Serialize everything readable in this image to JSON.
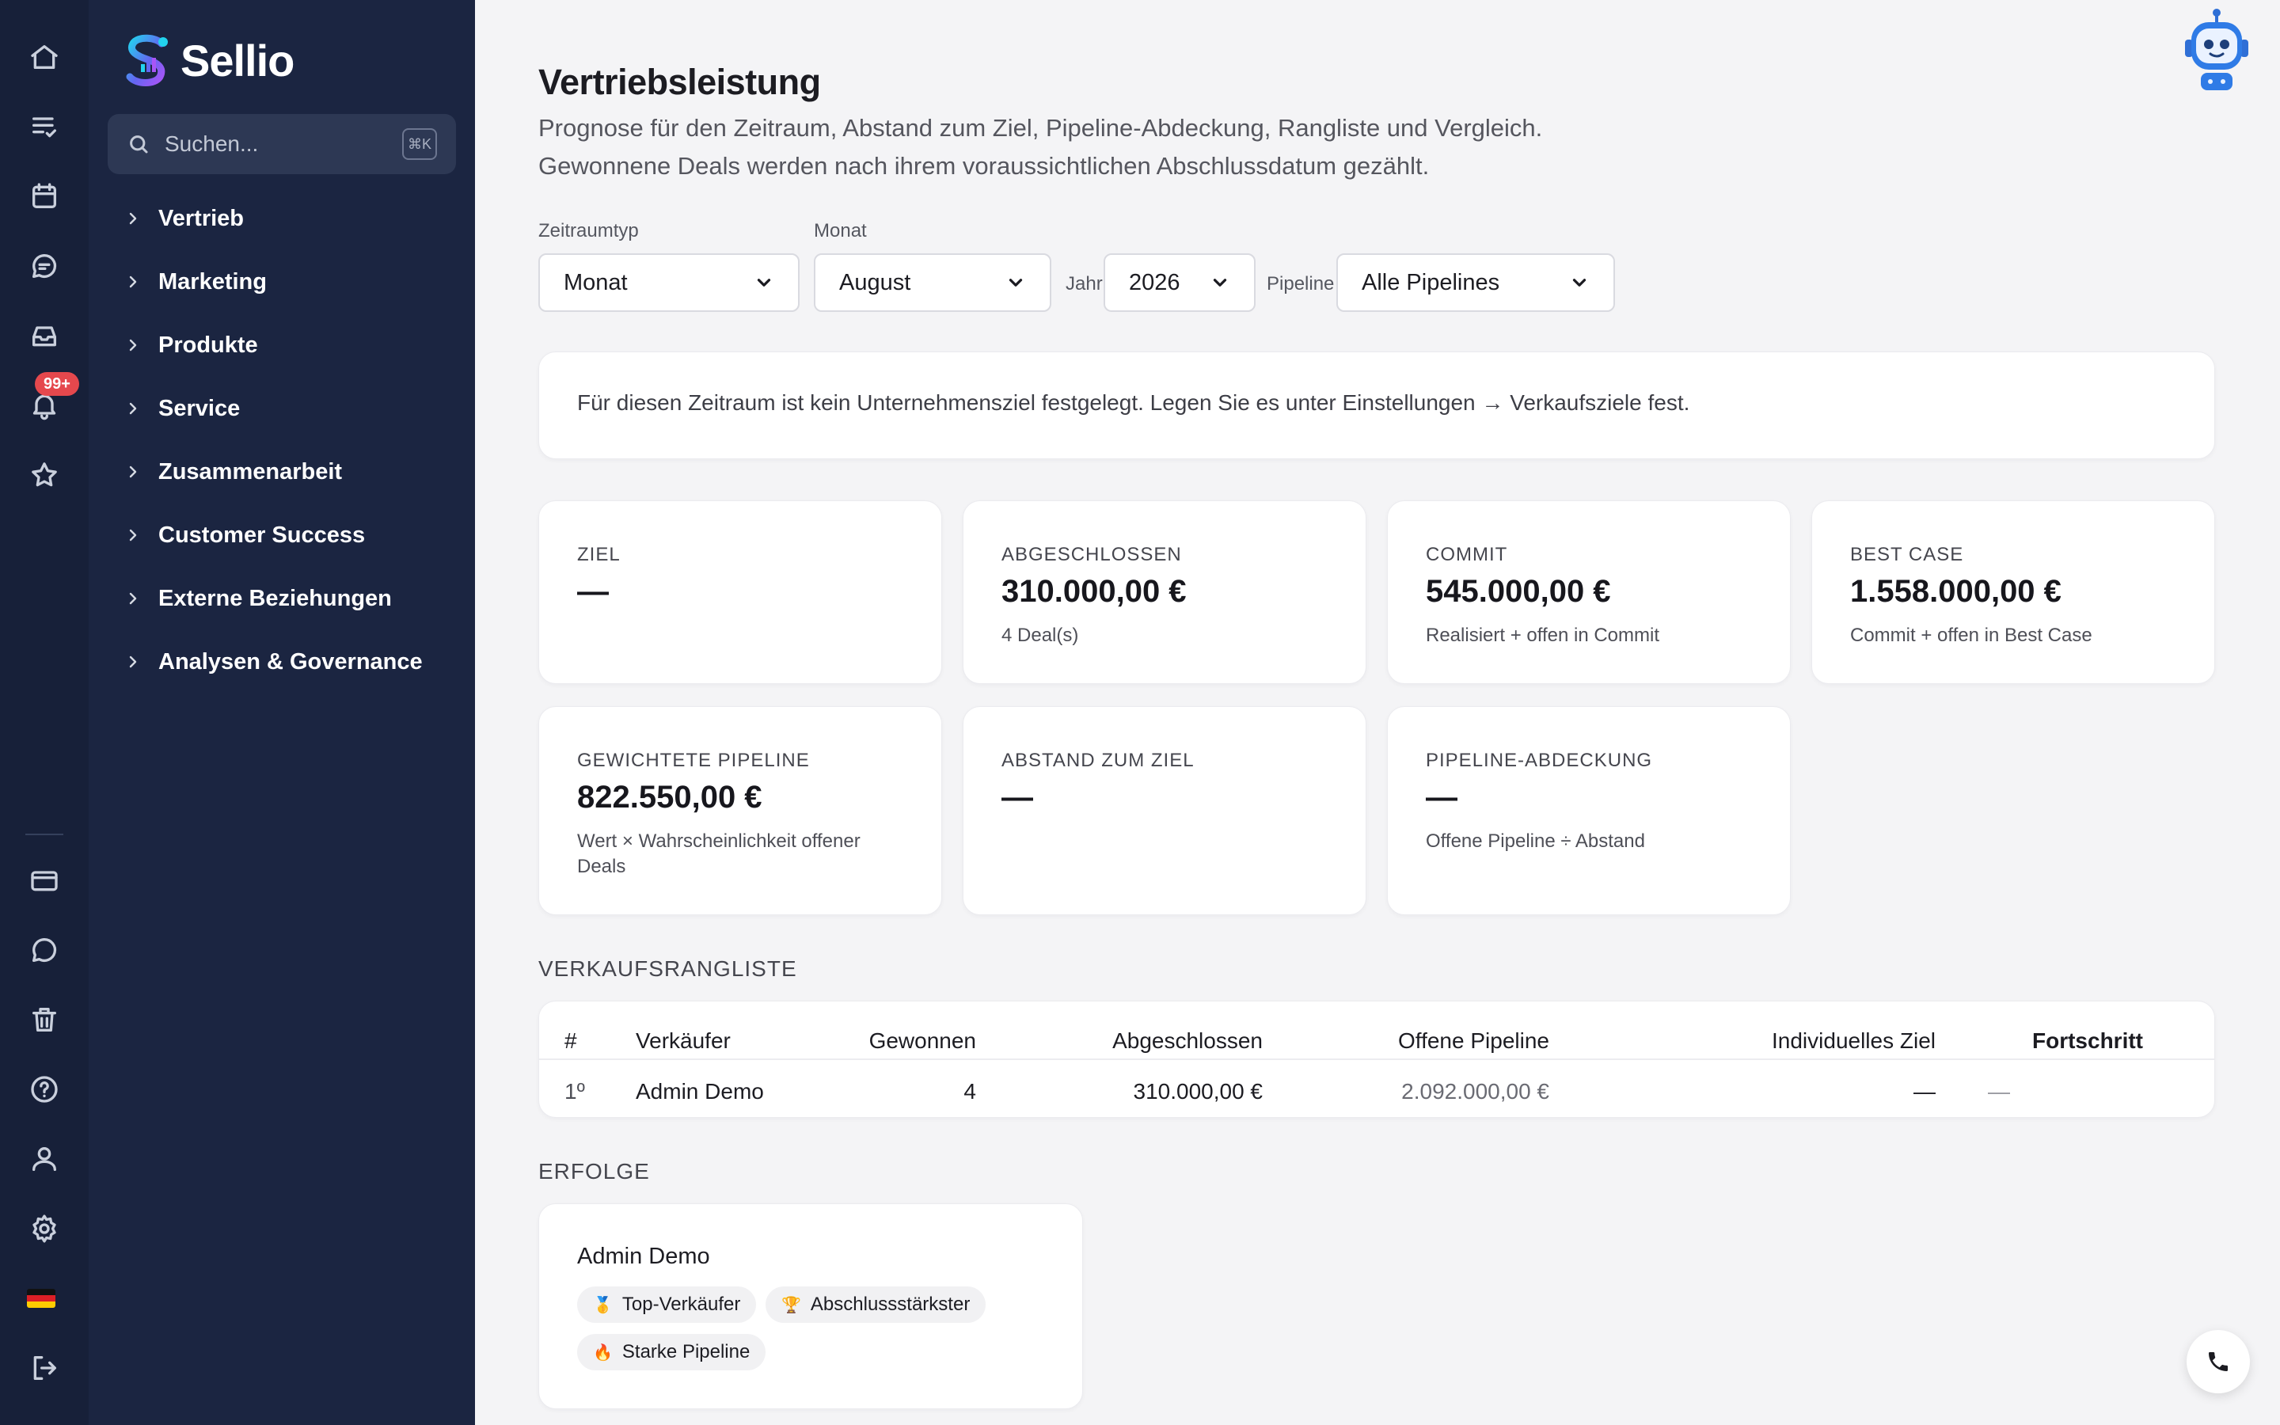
{
  "rail": {
    "notification_count": "99+",
    "icons": [
      "home-icon",
      "tasks-icon",
      "calendar-icon",
      "chat-icon",
      "inbox-icon",
      "bell-icon",
      "star-icon",
      "billing-icon",
      "message-icon",
      "trash-icon",
      "help-icon",
      "user-icon",
      "settings-icon",
      "language-flag-icon",
      "logout-icon"
    ]
  },
  "sidebar": {
    "brand": "Sellio",
    "search": {
      "placeholder": "Suchen...",
      "shortcut": "⌘K"
    },
    "items": [
      {
        "label": "Vertrieb"
      },
      {
        "label": "Marketing"
      },
      {
        "label": "Produkte"
      },
      {
        "label": "Service"
      },
      {
        "label": "Zusammenarbeit"
      },
      {
        "label": "Customer Success"
      },
      {
        "label": "Externe Beziehungen"
      },
      {
        "label": "Analysen & Governance"
      }
    ]
  },
  "header": {
    "title": "Vertriebsleistung",
    "subtitle_line1": "Prognose für den Zeitraum, Abstand zum Ziel, Pipeline-Abdeckung, Rangliste und Vergleich.",
    "subtitle_line2": "Gewonnene Deals werden nach ihrem voraussichtlichen Abschlussdatum gezählt."
  },
  "filters": {
    "period_type": {
      "label": "Zeitraumtyp",
      "value": "Monat"
    },
    "month": {
      "label": "Monat",
      "value": "August"
    },
    "year": {
      "label": "Jahr",
      "value": "2026"
    },
    "pipeline": {
      "label": "Pipeline",
      "value": "Alle Pipelines"
    }
  },
  "notice": "Für diesen Zeitraum ist kein Unternehmensziel festgelegt. Legen Sie es unter Einstellungen → Verkaufsziele fest.",
  "kpis": {
    "goal": {
      "label": "ZIEL",
      "value": "—"
    },
    "closed": {
      "label": "ABGESCHLOSSEN",
      "value": "310.000,00 €",
      "sub": "4 Deal(s)"
    },
    "commit": {
      "label": "COMMIT",
      "value": "545.000,00 €",
      "sub": "Realisiert + offen in Commit"
    },
    "best_case": {
      "label": "BEST CASE",
      "value": "1.558.000,00 €",
      "sub": "Commit + offen in Best Case"
    },
    "weighted": {
      "label": "GEWICHTETE PIPELINE",
      "value": "822.550,00 €",
      "sub": "Wert × Wahrscheinlichkeit offener Deals"
    },
    "gap": {
      "label": "ABSTAND ZUM ZIEL",
      "value": "—"
    },
    "coverage": {
      "label": "PIPELINE-ABDECKUNG",
      "value": "—",
      "sub": "Offene Pipeline ÷ Abstand"
    }
  },
  "leaderboard": {
    "title": "VERKAUFSRANGLISTE",
    "columns": {
      "rank": "#",
      "seller": "Verkäufer",
      "won": "Gewonnen",
      "closed": "Abgeschlossen",
      "open": "Offene Pipeline",
      "target": "Individuelles Ziel",
      "progress": "Fortschritt"
    },
    "rows": [
      {
        "rank": "1º",
        "seller": "Admin Demo",
        "won": "4",
        "closed": "310.000,00 €",
        "open": "2.092.000,00 €",
        "target": "—",
        "progress": "—"
      }
    ]
  },
  "achievements": {
    "title": "ERFOLGE",
    "person": "Admin Demo",
    "badges": [
      {
        "emoji": "🥇",
        "label": "Top-Verkäufer"
      },
      {
        "emoji": "🏆",
        "label": "Abschlussstärkster"
      },
      {
        "emoji": "🔥",
        "label": "Starke Pipeline"
      }
    ]
  },
  "colors": {
    "rail_bg": "#172039",
    "sidebar_bg": "#1b2541",
    "page_bg": "#f4f4f6",
    "badge_red": "#e5484d",
    "brand_gradient": [
      "#22d3ee",
      "#6366f1",
      "#a855f7"
    ]
  }
}
